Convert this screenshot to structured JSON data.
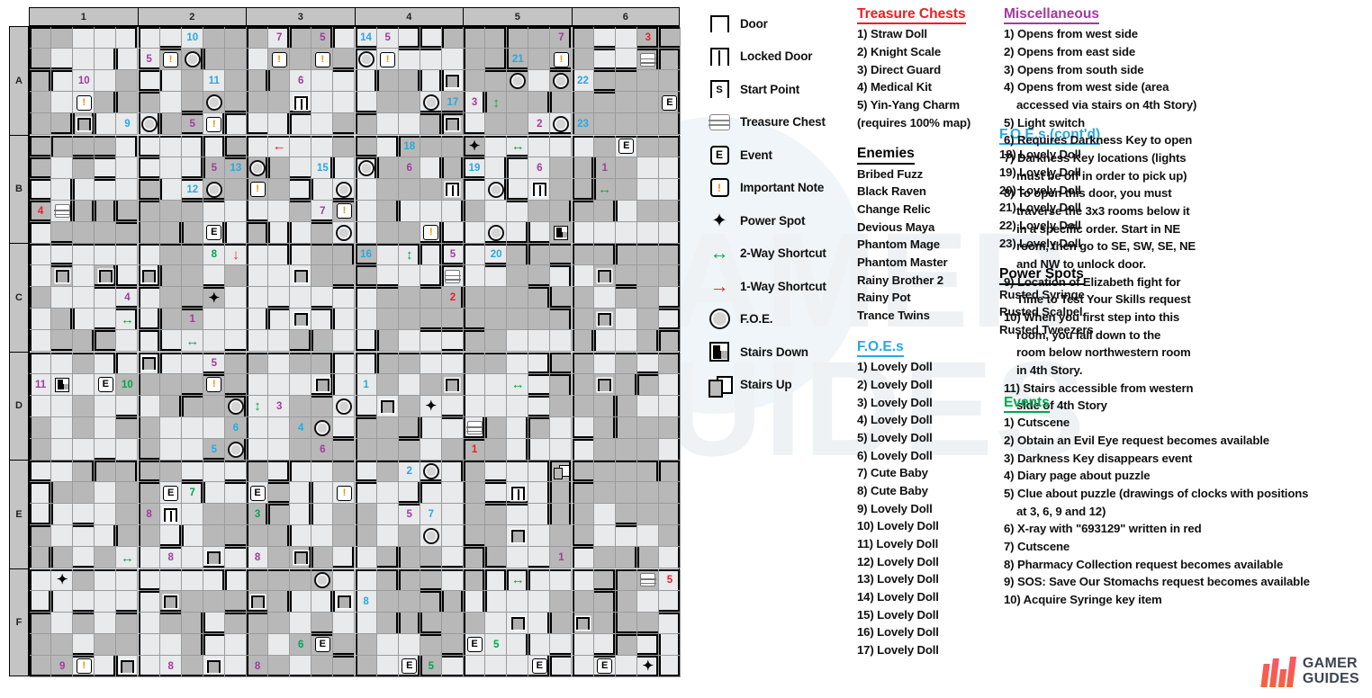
{
  "map": {
    "col_labels": [
      "1",
      "2",
      "3",
      "4",
      "5",
      "6"
    ],
    "row_labels": [
      "A",
      "B",
      "C",
      "D",
      "E",
      "F"
    ]
  },
  "legend": {
    "items": [
      {
        "icon": "door-icon",
        "label": "Door"
      },
      {
        "icon": "locked-door-icon",
        "label": "Locked Door"
      },
      {
        "icon": "start-point-icon",
        "label": "Start Point"
      },
      {
        "icon": "treasure-chest-icon",
        "label": "Treasure Chest"
      },
      {
        "icon": "event-icon",
        "label": "Event"
      },
      {
        "icon": "important-note-icon",
        "label": "Important Note"
      },
      {
        "icon": "power-spot-icon",
        "label": "Power Spot"
      },
      {
        "icon": "two-way-shortcut-icon",
        "label": "2-Way Shortcut"
      },
      {
        "icon": "one-way-shortcut-icon",
        "label": "1-Way Shortcut"
      },
      {
        "icon": "foe-icon",
        "label": "F.O.E."
      },
      {
        "icon": "stairs-down-icon",
        "label": "Stairs Down"
      },
      {
        "icon": "stairs-up-icon",
        "label": "Stairs Up"
      }
    ],
    "start_point_letter": "S",
    "event_letter": "E",
    "note_glyph": "!"
  },
  "treasure_chests": {
    "title": "Treasure Chests",
    "color": "#ee1c25",
    "items": [
      "1) Straw Doll",
      "2) Knight Scale",
      "3) Direct Guard",
      "4) Medical Kit",
      "5) Yin-Yang Charm (requires 100% map)"
    ]
  },
  "enemies": {
    "title": "Enemies",
    "color": "#000000",
    "items": [
      "Bribed Fuzz",
      "Black Raven",
      "Change Relic",
      "Devious Maya",
      "Phantom Mage",
      "Phantom Master",
      "Rainy Brother 2",
      "Rainy Pot",
      "Trance Twins"
    ]
  },
  "foes": {
    "title": "F.O.E.s",
    "color": "#29a8e0",
    "items": [
      "1) Lovely Doll",
      "2) Lovely Doll",
      "3) Lovely Doll",
      "4) Lovely Doll",
      "5) Lovely Doll",
      "6) Lovely Doll",
      "7) Cute Baby",
      "8) Cute Baby",
      "9) Lovely Doll",
      "10) Lovely Doll",
      "11) Lovely Doll",
      "12) Lovely Doll",
      "13) Lovely Doll",
      "14) Lovely Doll",
      "15) Lovely Doll",
      "16) Lovely Doll",
      "17) Lovely Doll"
    ]
  },
  "foes_cont": {
    "title": "F.O.E.s (cont'd)",
    "color": "#29a8e0",
    "items": [
      "18) Lovely Doll",
      "19) Lovely Doll",
      "20) Lovely Doll",
      "21) Lovely Doll",
      "22) Lovely Doll",
      "23) Lovely Doll"
    ]
  },
  "power_spots": {
    "title": "Power Spots",
    "color": "#000000",
    "items": [
      "Rusted Syringe",
      "Rusted Scalpel",
      "Rusted Tweezers"
    ]
  },
  "miscellaneous": {
    "title": "Miscellaneous",
    "color": "#a33a9e",
    "items": [
      {
        "text": "1) Opens from west side",
        "cont": []
      },
      {
        "text": "2) Opens from east side",
        "cont": []
      },
      {
        "text": "3) Opens from south side",
        "cont": []
      },
      {
        "text": "4) Opens from west side (area",
        "cont": [
          "accessed via stairs on 4th Story)"
        ]
      },
      {
        "text": "5) Light switch",
        "cont": []
      },
      {
        "text": "6) Requires Darkness Key to open",
        "cont": []
      },
      {
        "text": "7) Darkness Key locations (lights",
        "cont": [
          "must be off in order to pick up)"
        ]
      },
      {
        "text": "8) To open this door, you must",
        "cont": [
          "traverse the 3x3 rooms below it",
          "in a specific order. Start in NE",
          "room, then go to SE, SW, SE, NE",
          "and NW to unlock door."
        ]
      },
      {
        "text": "9) Location of Elizabeth fight for",
        "cont": [
          "Time to Test Your Skills request"
        ]
      },
      {
        "text": "10) When you first step into this",
        "cont": [
          "room, you fall down to the",
          "room below northwestern room",
          "in 4th Story."
        ]
      },
      {
        "text": "11) Stairs accessible from western",
        "cont": [
          "side of 4th Story"
        ]
      }
    ]
  },
  "events": {
    "title": "Events",
    "color": "#00a650",
    "items": [
      {
        "text": "1) Cutscene",
        "cont": []
      },
      {
        "text": "2) Obtain an Evil Eye request becomes available",
        "cont": []
      },
      {
        "text": "3) Darkness Key disappears event",
        "cont": []
      },
      {
        "text": "4) Diary page about puzzle",
        "cont": []
      },
      {
        "text": "5) Clue about puzzle (drawings of clocks with positions",
        "cont": [
          "at 3, 6, 9 and 12)"
        ]
      },
      {
        "text": "6) X-ray with \"693129\" written in red",
        "cont": []
      },
      {
        "text": "7) Cutscene",
        "cont": []
      },
      {
        "text": "8) Pharmacy Collection request becomes available",
        "cont": []
      },
      {
        "text": "9) SOS: Save Our Stomachs request becomes available",
        "cont": []
      },
      {
        "text": "10) Acquire Syringe key item",
        "cont": []
      }
    ]
  },
  "brand": {
    "line1": "GAMER",
    "line2": "GUIDES"
  },
  "watermark": {
    "text": "GAMER GUIDES"
  },
  "map_markers": [
    {
      "c": 7,
      "r": 0,
      "type": "num",
      "text": "10",
      "color": "blue"
    },
    {
      "c": 11,
      "r": 0,
      "type": "num",
      "text": "7",
      "color": "purple"
    },
    {
      "c": 13,
      "r": 0,
      "type": "num",
      "text": "5",
      "color": "purple"
    },
    {
      "c": 15,
      "r": 0,
      "type": "num",
      "text": "14",
      "color": "blue"
    },
    {
      "c": 16,
      "r": 0,
      "type": "num",
      "text": "5",
      "color": "purple"
    },
    {
      "c": 24,
      "r": 0,
      "type": "num",
      "text": "7",
      "color": "purple"
    },
    {
      "c": 28,
      "r": 0,
      "type": "num",
      "text": "3",
      "color": "red"
    },
    {
      "c": 5,
      "r": 1,
      "type": "num",
      "text": "5",
      "color": "purple"
    },
    {
      "c": 6,
      "r": 1,
      "type": "note"
    },
    {
      "c": 7,
      "r": 1,
      "type": "foe"
    },
    {
      "c": 11,
      "r": 1,
      "type": "note"
    },
    {
      "c": 13,
      "r": 1,
      "type": "note"
    },
    {
      "c": 15,
      "r": 1,
      "type": "foe"
    },
    {
      "c": 16,
      "r": 1,
      "type": "note"
    },
    {
      "c": 22,
      "r": 1,
      "type": "num",
      "text": "21",
      "color": "blue"
    },
    {
      "c": 24,
      "r": 1,
      "type": "note"
    },
    {
      "c": 28,
      "r": 1,
      "type": "chest"
    },
    {
      "c": 2,
      "r": 2,
      "type": "num",
      "text": "10",
      "color": "purple"
    },
    {
      "c": 8,
      "r": 2,
      "type": "num",
      "text": "11",
      "color": "blue"
    },
    {
      "c": 12,
      "r": 2,
      "type": "num",
      "text": "6",
      "color": "purple"
    },
    {
      "c": 19,
      "r": 2,
      "type": "door"
    },
    {
      "c": 22,
      "r": 2,
      "type": "foe"
    },
    {
      "c": 24,
      "r": 2,
      "type": "foe"
    },
    {
      "c": 25,
      "r": 2,
      "type": "num",
      "text": "22",
      "color": "blue"
    },
    {
      "c": 2,
      "r": 3,
      "type": "note"
    },
    {
      "c": 8,
      "r": 3,
      "type": "foe"
    },
    {
      "c": 12,
      "r": 3,
      "type": "lockdoor"
    },
    {
      "c": 18,
      "r": 3,
      "type": "foe"
    },
    {
      "c": 19,
      "r": 3,
      "type": "num",
      "text": "17",
      "color": "blue"
    },
    {
      "c": 20,
      "r": 3,
      "type": "num",
      "text": "3",
      "color": "purple"
    },
    {
      "c": 21,
      "r": 3,
      "type": "arrow2v"
    },
    {
      "c": 29,
      "r": 3,
      "type": "event"
    },
    {
      "c": 2,
      "r": 4,
      "type": "door"
    },
    {
      "c": 4,
      "r": 4,
      "type": "num",
      "text": "9",
      "color": "blue"
    },
    {
      "c": 5,
      "r": 4,
      "type": "foe"
    },
    {
      "c": 7,
      "r": 4,
      "type": "num",
      "text": "5",
      "color": "purple"
    },
    {
      "c": 8,
      "r": 4,
      "type": "note"
    },
    {
      "c": 19,
      "r": 4,
      "type": "door"
    },
    {
      "c": 23,
      "r": 4,
      "type": "num",
      "text": "2",
      "color": "purple"
    },
    {
      "c": 24,
      "r": 4,
      "type": "foe"
    },
    {
      "c": 25,
      "r": 4,
      "type": "num",
      "text": "23",
      "color": "blue"
    },
    {
      "c": 11,
      "r": 5,
      "type": "arrow1left"
    },
    {
      "c": 17,
      "r": 5,
      "type": "num",
      "text": "18",
      "color": "blue"
    },
    {
      "c": 20,
      "r": 5,
      "type": "pspot"
    },
    {
      "c": 22,
      "r": 5,
      "type": "arrow2h"
    },
    {
      "c": 27,
      "r": 5,
      "type": "event"
    },
    {
      "c": 8,
      "r": 6,
      "type": "num",
      "text": "5",
      "color": "purple"
    },
    {
      "c": 9,
      "r": 6,
      "type": "num",
      "text": "13",
      "color": "blue"
    },
    {
      "c": 10,
      "r": 6,
      "type": "foe"
    },
    {
      "c": 13,
      "r": 6,
      "type": "num",
      "text": "15",
      "color": "blue"
    },
    {
      "c": 15,
      "r": 6,
      "type": "foe"
    },
    {
      "c": 17,
      "r": 6,
      "type": "num",
      "text": "6",
      "color": "purple"
    },
    {
      "c": 20,
      "r": 6,
      "type": "num",
      "text": "19",
      "color": "blue"
    },
    {
      "c": 23,
      "r": 6,
      "type": "num",
      "text": "6",
      "color": "purple"
    },
    {
      "c": 26,
      "r": 6,
      "type": "num",
      "text": "1",
      "color": "purple"
    },
    {
      "c": 7,
      "r": 7,
      "type": "num",
      "text": "12",
      "color": "blue"
    },
    {
      "c": 8,
      "r": 7,
      "type": "foe"
    },
    {
      "c": 10,
      "r": 7,
      "type": "note"
    },
    {
      "c": 14,
      "r": 7,
      "type": "foe"
    },
    {
      "c": 19,
      "r": 7,
      "type": "lockdoor"
    },
    {
      "c": 21,
      "r": 7,
      "type": "foe"
    },
    {
      "c": 23,
      "r": 7,
      "type": "lockdoor"
    },
    {
      "c": 26,
      "r": 7,
      "type": "arrow2h"
    },
    {
      "c": 0,
      "r": 8,
      "type": "num",
      "text": "4",
      "color": "red"
    },
    {
      "c": 1,
      "r": 8,
      "type": "chest"
    },
    {
      "c": 13,
      "r": 8,
      "type": "num",
      "text": "7",
      "color": "purple"
    },
    {
      "c": 14,
      "r": 8,
      "type": "note"
    },
    {
      "c": 8,
      "r": 9,
      "type": "event"
    },
    {
      "c": 14,
      "r": 9,
      "type": "foe"
    },
    {
      "c": 18,
      "r": 9,
      "type": "note"
    },
    {
      "c": 21,
      "r": 9,
      "type": "foe"
    },
    {
      "c": 24,
      "r": 9,
      "type": "stairsdown"
    },
    {
      "c": 8,
      "r": 10,
      "type": "num",
      "text": "8",
      "color": "green"
    },
    {
      "c": 9,
      "r": 10,
      "type": "arrow1down"
    },
    {
      "c": 15,
      "r": 10,
      "type": "num",
      "text": "16",
      "color": "blue"
    },
    {
      "c": 17,
      "r": 10,
      "type": "arrow2v"
    },
    {
      "c": 19,
      "r": 10,
      "type": "num",
      "text": "5",
      "color": "purple"
    },
    {
      "c": 21,
      "r": 10,
      "type": "num",
      "text": "20",
      "color": "blue"
    },
    {
      "c": 1,
      "r": 11,
      "type": "door"
    },
    {
      "c": 3,
      "r": 11,
      "type": "door"
    },
    {
      "c": 5,
      "r": 11,
      "type": "door"
    },
    {
      "c": 12,
      "r": 11,
      "type": "door"
    },
    {
      "c": 19,
      "r": 11,
      "type": "chest"
    },
    {
      "c": 26,
      "r": 11,
      "type": "door"
    },
    {
      "c": 4,
      "r": 12,
      "type": "num",
      "text": "4",
      "color": "purple"
    },
    {
      "c": 8,
      "r": 12,
      "type": "pspot"
    },
    {
      "c": 19,
      "r": 12,
      "type": "num",
      "text": "2",
      "color": "red"
    },
    {
      "c": 4,
      "r": 13,
      "type": "arrow2h"
    },
    {
      "c": 7,
      "r": 13,
      "type": "num",
      "text": "1",
      "color": "purple"
    },
    {
      "c": 12,
      "r": 13,
      "type": "door"
    },
    {
      "c": 26,
      "r": 13,
      "type": "door"
    },
    {
      "c": 7,
      "r": 14,
      "type": "arrow2h"
    },
    {
      "c": 5,
      "r": 15,
      "type": "door"
    },
    {
      "c": 8,
      "r": 15,
      "type": "num",
      "text": "5",
      "color": "purple"
    },
    {
      "c": 0,
      "r": 16,
      "type": "num",
      "text": "11",
      "color": "purple"
    },
    {
      "c": 1,
      "r": 16,
      "type": "stairsdown"
    },
    {
      "c": 3,
      "r": 16,
      "type": "event"
    },
    {
      "c": 4,
      "r": 16,
      "type": "num",
      "text": "10",
      "color": "green"
    },
    {
      "c": 8,
      "r": 16,
      "type": "note"
    },
    {
      "c": 13,
      "r": 16,
      "type": "door"
    },
    {
      "c": 15,
      "r": 16,
      "type": "num",
      "text": "1",
      "color": "blue"
    },
    {
      "c": 19,
      "r": 16,
      "type": "door"
    },
    {
      "c": 22,
      "r": 16,
      "type": "arrow2h"
    },
    {
      "c": 26,
      "r": 16,
      "type": "door"
    },
    {
      "c": 9,
      "r": 17,
      "type": "foe"
    },
    {
      "c": 10,
      "r": 17,
      "type": "arrow2v"
    },
    {
      "c": 11,
      "r": 17,
      "type": "num",
      "text": "3",
      "color": "purple"
    },
    {
      "c": 14,
      "r": 17,
      "type": "foe"
    },
    {
      "c": 16,
      "r": 17,
      "type": "door"
    },
    {
      "c": 18,
      "r": 17,
      "type": "pspot"
    },
    {
      "c": 9,
      "r": 18,
      "type": "num",
      "text": "6",
      "color": "blue"
    },
    {
      "c": 12,
      "r": 18,
      "type": "num",
      "text": "4",
      "color": "blue"
    },
    {
      "c": 13,
      "r": 18,
      "type": "foe"
    },
    {
      "c": 20,
      "r": 18,
      "type": "chest"
    },
    {
      "c": 8,
      "r": 19,
      "type": "num",
      "text": "5",
      "color": "blue"
    },
    {
      "c": 9,
      "r": 19,
      "type": "foe"
    },
    {
      "c": 13,
      "r": 19,
      "type": "num",
      "text": "6",
      "color": "purple"
    },
    {
      "c": 20,
      "r": 19,
      "type": "num",
      "text": "1",
      "color": "red"
    },
    {
      "c": 17,
      "r": 20,
      "type": "num",
      "text": "2",
      "color": "blue"
    },
    {
      "c": 18,
      "r": 20,
      "type": "foe"
    },
    {
      "c": 24,
      "r": 20,
      "type": "stairsup"
    },
    {
      "c": 6,
      "r": 21,
      "type": "event"
    },
    {
      "c": 7,
      "r": 21,
      "type": "num",
      "text": "7",
      "color": "green"
    },
    {
      "c": 10,
      "r": 21,
      "type": "event"
    },
    {
      "c": 14,
      "r": 21,
      "type": "note"
    },
    {
      "c": 22,
      "r": 21,
      "type": "lockdoor"
    },
    {
      "c": 5,
      "r": 22,
      "type": "num",
      "text": "8",
      "color": "purple"
    },
    {
      "c": 6,
      "r": 22,
      "type": "lockdoor"
    },
    {
      "c": 10,
      "r": 22,
      "type": "num",
      "text": "3",
      "color": "green"
    },
    {
      "c": 17,
      "r": 22,
      "type": "num",
      "text": "5",
      "color": "purple"
    },
    {
      "c": 18,
      "r": 22,
      "type": "num",
      "text": "7",
      "color": "blue"
    },
    {
      "c": 18,
      "r": 23,
      "type": "foe"
    },
    {
      "c": 22,
      "r": 23,
      "type": "door"
    },
    {
      "c": 4,
      "r": 24,
      "type": "arrow2h"
    },
    {
      "c": 6,
      "r": 24,
      "type": "num",
      "text": "8",
      "color": "purple"
    },
    {
      "c": 8,
      "r": 24,
      "type": "door"
    },
    {
      "c": 10,
      "r": 24,
      "type": "num",
      "text": "8",
      "color": "purple"
    },
    {
      "c": 12,
      "r": 24,
      "type": "door"
    },
    {
      "c": 24,
      "r": 24,
      "type": "num",
      "text": "1",
      "color": "purple"
    },
    {
      "c": 1,
      "r": 25,
      "type": "pspot"
    },
    {
      "c": 13,
      "r": 25,
      "type": "foe"
    },
    {
      "c": 22,
      "r": 25,
      "type": "arrow2h"
    },
    {
      "c": 28,
      "r": 25,
      "type": "chest"
    },
    {
      "c": 29,
      "r": 25,
      "type": "num",
      "text": "5",
      "color": "red"
    },
    {
      "c": 6,
      "r": 26,
      "type": "door"
    },
    {
      "c": 10,
      "r": 26,
      "type": "door"
    },
    {
      "c": 14,
      "r": 26,
      "type": "door"
    },
    {
      "c": 15,
      "r": 26,
      "type": "num",
      "text": "8",
      "color": "blue"
    },
    {
      "c": 22,
      "r": 27,
      "type": "door"
    },
    {
      "c": 25,
      "r": 27,
      "type": "door"
    },
    {
      "c": 12,
      "r": 28,
      "type": "num",
      "text": "6",
      "color": "green"
    },
    {
      "c": 13,
      "r": 28,
      "type": "event"
    },
    {
      "c": 20,
      "r": 28,
      "type": "event"
    },
    {
      "c": 21,
      "r": 28,
      "type": "num",
      "text": "5",
      "color": "green"
    },
    {
      "c": 1,
      "r": 29,
      "type": "num",
      "text": "9",
      "color": "purple"
    },
    {
      "c": 2,
      "r": 29,
      "type": "note"
    },
    {
      "c": 4,
      "r": 29,
      "type": "door"
    },
    {
      "c": 6,
      "r": 29,
      "type": "num",
      "text": "8",
      "color": "purple"
    },
    {
      "c": 8,
      "r": 29,
      "type": "door"
    },
    {
      "c": 10,
      "r": 29,
      "type": "num",
      "text": "8",
      "color": "purple"
    },
    {
      "c": 17,
      "r": 29,
      "type": "event"
    },
    {
      "c": 18,
      "r": 29,
      "type": "num",
      "text": "5",
      "color": "green"
    },
    {
      "c": 23,
      "r": 29,
      "type": "event"
    },
    {
      "c": 26,
      "r": 29,
      "type": "event"
    },
    {
      "c": 28,
      "r": 29,
      "type": "pspot"
    }
  ]
}
